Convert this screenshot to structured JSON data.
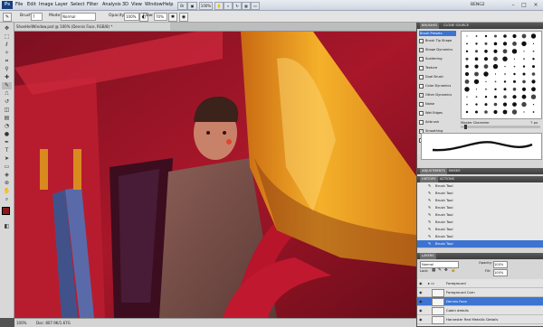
{
  "app": {
    "logo": "Ps",
    "menu": [
      "File",
      "Edit",
      "Image",
      "Layer",
      "Select",
      "Filter",
      "Analysis",
      "3D",
      "View",
      "Window",
      "Help"
    ],
    "zoom": "100%",
    "workspace": "BENG2"
  },
  "options": {
    "brush_label": "Brush:",
    "brush_size": "7",
    "mode_label": "Mode:",
    "mode_value": "Normal",
    "opacity_label": "Opacity:",
    "opacity_value": "100%",
    "flow_label": "Flow:",
    "flow_value": "70%"
  },
  "document": {
    "tab_title": "ShoeHellWindow.psd @ 100% (Dennis Face, RGB/8) *",
    "status_zoom": "100%",
    "status_doc": "Doc: 807.9K/1.67G"
  },
  "brushes_panel": {
    "tabs": [
      "BRUSHES",
      "CLONE SOURCE"
    ],
    "presets_label": "Brush Presets",
    "options": [
      {
        "label": "Brush Tip Shape",
        "checked": false
      },
      {
        "label": "Shape Dynamics",
        "checked": true
      },
      {
        "label": "Scattering",
        "checked": false
      },
      {
        "label": "Texture",
        "checked": false
      },
      {
        "label": "Dual Brush",
        "checked": false
      },
      {
        "label": "Color Dynamics",
        "checked": false
      },
      {
        "label": "Other Dynamics",
        "checked": true
      },
      {
        "label": "Noise",
        "checked": false
      },
      {
        "label": "Wet Edges",
        "checked": false
      },
      {
        "label": "Airbrush",
        "checked": false
      },
      {
        "label": "Smoothing",
        "checked": true
      },
      {
        "label": "Protect Texture",
        "checked": false
      }
    ],
    "master_diameter_label": "Master Diameter",
    "master_diameter_value": "7 px"
  },
  "adjustments_panel": {
    "tabs": [
      "ADJUSTMENTS",
      "MASKS"
    ]
  },
  "history_panel": {
    "tabs": [
      "HISTORY",
      "ACTIONS"
    ],
    "items": [
      "Brush Tool",
      "Brush Tool",
      "Brush Tool",
      "Brush Tool",
      "Brush Tool",
      "Brush Tool",
      "Brush Tool",
      "Brush Tool",
      "Brush Tool"
    ],
    "selected_index": 8
  },
  "layers_panel": {
    "tabs": [
      "LAYERS"
    ],
    "blend_mode": "Normal",
    "opacity_label": "Opacity:",
    "opacity_value": "100%",
    "lock_label": "Lock:",
    "fill_label": "Fill:",
    "fill_value": "100%",
    "layers": [
      {
        "name": "Foreground",
        "type": "group",
        "visible": true
      },
      {
        "name": "Foreground Corn",
        "type": "layer",
        "visible": true
      },
      {
        "name": "Dennis Face",
        "type": "layer",
        "visible": true,
        "selected": true
      },
      {
        "name": "Cabin details",
        "type": "layer",
        "visible": true
      },
      {
        "name": "Harvester Red Metallic Details",
        "type": "layer",
        "visible": true
      }
    ]
  },
  "colors": {
    "accent": "#3d74d2",
    "canvas_red": "#a8172a",
    "tank_yellow": "#f0a21a",
    "foreground_color": "#8b1a1a",
    "background_color": "#ffffff"
  }
}
